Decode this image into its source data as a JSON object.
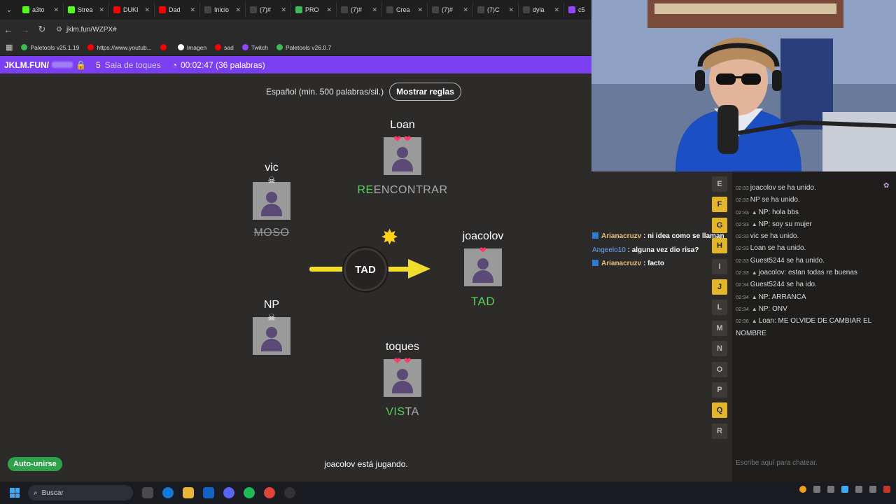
{
  "browser": {
    "tabs": [
      {
        "title": "a3to",
        "icon": "kick-icon",
        "color": "#53fc18"
      },
      {
        "title": "Strea",
        "icon": "kick-icon",
        "color": "#53fc18"
      },
      {
        "title": "DUKI",
        "icon": "youtube-icon",
        "color": "#ff0000"
      },
      {
        "title": "Dad",
        "icon": "youtube-icon",
        "color": "#ff0000"
      },
      {
        "title": "Inicio",
        "icon": "x-icon",
        "color": "#ffffff"
      },
      {
        "title": "(7)#",
        "icon": "tiktok-icon",
        "color": "#ffffff"
      },
      {
        "title": "PRO",
        "icon": "paletools-icon",
        "color": "#3cba54"
      },
      {
        "title": "(7)#",
        "icon": "tiktok-icon",
        "color": "#ffffff"
      },
      {
        "title": "Crea",
        "icon": "edit-icon",
        "color": "#ffffff"
      },
      {
        "title": "(7)#",
        "icon": "tiktok-icon",
        "color": "#ffffff"
      },
      {
        "title": "(7)C",
        "icon": "tiktok-icon",
        "color": "#ffffff"
      },
      {
        "title": "dyla",
        "icon": "google-icon",
        "color": "#ffffff"
      },
      {
        "title": "c5",
        "icon": "twitch-icon",
        "color": "#9146ff"
      }
    ],
    "url": "jklm.fun/WZPX#",
    "bookmarks": [
      {
        "label": "Paletools v25.1.19",
        "color": "#3cba54"
      },
      {
        "label": "https://www.youtub...",
        "color": "#ff0000"
      },
      {
        "label": "",
        "color": "#ff0000"
      },
      {
        "label": "Imagen",
        "color": "#ffffff"
      },
      {
        "label": "sad",
        "color": "#ff0000"
      },
      {
        "label": "Twitch",
        "color": "#9146ff"
      },
      {
        "label": "Paletools v26.0.7",
        "color": "#3cba54"
      }
    ]
  },
  "header": {
    "site": "JKLM.FUN/",
    "count": "5",
    "room": "Sala de toques",
    "timer": "00:02:47 (36 palabras)"
  },
  "game": {
    "language": "Español (min. 500 palabras/sil.)",
    "rules_button": "Mostrar reglas",
    "bomb_syllable": "TAD",
    "players": [
      {
        "name": "Loan",
        "status": "hearts",
        "word_ok": "RE",
        "word_rest": "ENCONTRAR"
      },
      {
        "name": "vic",
        "status": "dead",
        "word_ok": "",
        "word_rest": "MOSO"
      },
      {
        "name": "joacolov",
        "status": "heart",
        "word_ok": "TAD",
        "word_rest": ""
      },
      {
        "name": "NP",
        "status": "dead",
        "word_ok": "",
        "word_rest": ""
      },
      {
        "name": "toques",
        "status": "hearts",
        "word_ok": "VIS",
        "word_rest": "TA"
      }
    ],
    "status": "joacolov está jugando.",
    "auto_join": "Auto-unirse"
  },
  "overlay_chat": [
    {
      "user": "Arianacruzv",
      "text": ": ni idea como se llaman"
    },
    {
      "user": "Angeelo10",
      "text": ": alguna vez dio risa?"
    },
    {
      "user": "Arianacruzv",
      "text": ": facto"
    }
  ],
  "letters": [
    {
      "l": "E",
      "used": false
    },
    {
      "l": "F",
      "used": true
    },
    {
      "l": "G",
      "used": true
    },
    {
      "l": "H",
      "used": true
    },
    {
      "l": "I",
      "used": false
    },
    {
      "l": "J",
      "used": true
    },
    {
      "l": "L",
      "used": false
    },
    {
      "l": "M",
      "used": false
    },
    {
      "l": "N",
      "used": false
    },
    {
      "l": "O",
      "used": false
    },
    {
      "l": "P",
      "used": false
    },
    {
      "l": "Q",
      "used": true
    },
    {
      "l": "R",
      "used": false
    }
  ],
  "chat": {
    "messages": [
      {
        "time": "02:33",
        "player": false,
        "text": "joacolov se ha unido."
      },
      {
        "time": "02:33",
        "player": false,
        "text": "NP se ha unido."
      },
      {
        "time": "02:33",
        "player": true,
        "text": "NP: hola bbs"
      },
      {
        "time": "02:33",
        "player": true,
        "text": "NP: soy su mujer"
      },
      {
        "time": "02:33",
        "player": false,
        "text": "vic se ha unido."
      },
      {
        "time": "02:33",
        "player": false,
        "text": "Loan se ha unido."
      },
      {
        "time": "02:33",
        "player": false,
        "text": "Guest5244 se ha unido."
      },
      {
        "time": "02:33",
        "player": true,
        "text": "joacolov: estan todas re buenas"
      },
      {
        "time": "02:34",
        "player": false,
        "text": "Guest5244 se ha ido."
      },
      {
        "time": "02:34",
        "player": true,
        "text": "NP: ARRANCA"
      },
      {
        "time": "02:34",
        "player": true,
        "text": "NP: ONV"
      },
      {
        "time": "02:36",
        "player": true,
        "text": "Loan: ME OLVIDE DE CAMBIAR EL NOMBRE"
      }
    ],
    "placeholder": "Escribe aquí para chatear."
  },
  "taskbar": {
    "search": "Buscar"
  }
}
